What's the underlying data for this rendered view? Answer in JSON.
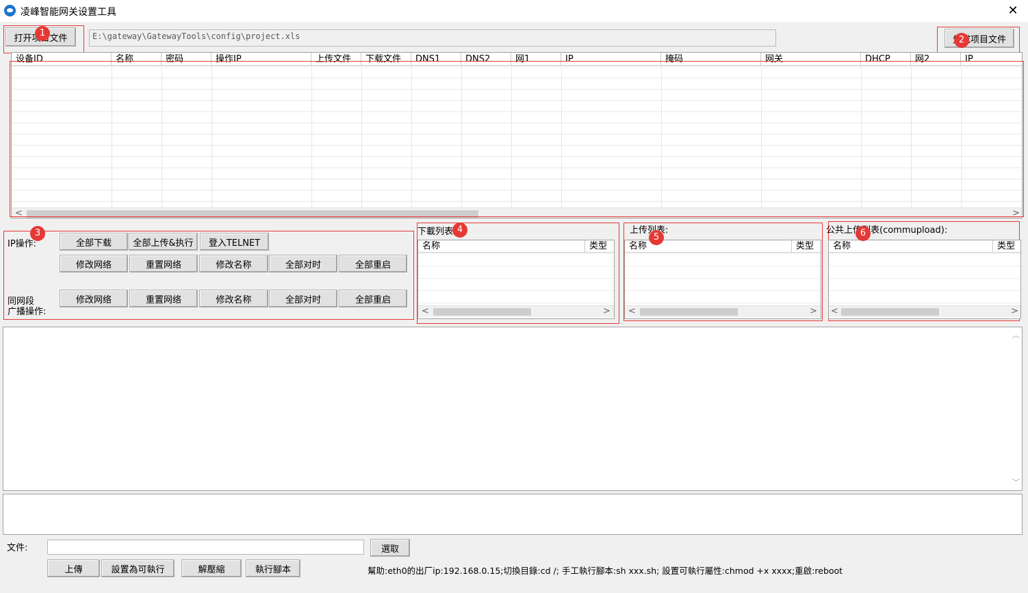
{
  "window": {
    "title": "凌峰智能网关设置工具",
    "close_glyph": "✕"
  },
  "top": {
    "open_button": "打开项目文件",
    "path_value": "E:\\gateway\\GatewayTools\\config\\project.xls",
    "generate_button": "生成项目文件"
  },
  "grid": {
    "columns": [
      "设备ID",
      "名称",
      "密码",
      "操作IP",
      "上传文件",
      "下载文件",
      "DNS1",
      "DNS2",
      "网1",
      "IP",
      "掩码",
      "网关",
      "DHCP",
      "网2",
      "IP"
    ],
    "row_count": 0,
    "scroll_left": "<",
    "scroll_right": ">"
  },
  "ip_ops": {
    "label": "IP操作:",
    "row1": [
      "全部下载",
      "全部上传&执行",
      "登入TELNET"
    ],
    "row2": [
      "修改网络",
      "重置网络",
      "修改名称",
      "全部对时",
      "全部重启"
    ]
  },
  "broadcast_ops": {
    "label_line1": "同网段",
    "label_line2": "广播操作:",
    "row": [
      "修改网络",
      "重置网络",
      "修改名称",
      "全部对时",
      "全部重启"
    ]
  },
  "download_list": {
    "title": "下載列表:",
    "col_name": "名称",
    "col_type": "类型"
  },
  "upload_list": {
    "title": "上传列表:",
    "col_name": "名称",
    "col_type": "类型"
  },
  "public_upload_list": {
    "title": "公共上传列表(commupload):",
    "col_name": "名称",
    "col_type": "类型"
  },
  "log": {
    "content": "",
    "scroll_up": "︿",
    "scroll_down": "﹀"
  },
  "bottom": {
    "file_label": "文件:",
    "file_value": "",
    "select_button": "選取",
    "upload_button": "上傳",
    "set_exec_button": "設置為可執行",
    "unzip_button": "解壓縮",
    "run_script_button": "執行腳本",
    "help_text": "幫助:eth0的出厂ip:192.168.0.15;切換目錄:cd /; 手工執行腳本:sh xxx.sh; 設置可執行屬性:chmod +x xxxx;重啟:reboot"
  },
  "annotations": [
    "1",
    "2",
    "3",
    "4",
    "5",
    "6"
  ],
  "colors": {
    "annotation_red": "#e53935",
    "window_bg": "#f0f0f0",
    "app_icon_blue": "#1a73c9"
  }
}
